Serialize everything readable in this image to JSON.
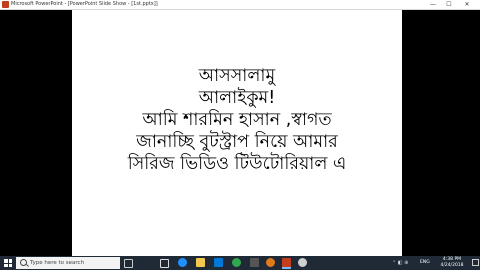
{
  "window": {
    "title": "Microsoft PowerPoint - [PowerPoint Slide Show - [1st.pptx]]",
    "minimize_glyph": "—",
    "maximize_glyph": "☐",
    "close_glyph": "✕"
  },
  "slide": {
    "lines": [
      "আসসালামু",
      "আলাইকুম!",
      "আমি শারমিন হাসান ,স্বাগত",
      "জানাচ্ছি বুটস্ট্রাপ নিয়ে আমার",
      "সিরিজ ভিডিও টিউটোরিয়াল এ"
    ]
  },
  "taskbar": {
    "search_placeholder": "Type here to search",
    "lang": "ENG",
    "time": "4:38 PM",
    "date": "4/24/2018",
    "colors": {
      "background": "#1f2a36",
      "edge": "#1e90ff",
      "store": "#0078d7",
      "explorer": "#f2c94c",
      "chrome": "#2fa84f",
      "powerpoint": "#c43e1c",
      "app_orange": "#e07b1a",
      "camera": "#cfcfcf"
    },
    "apps": [
      "task-view-icon",
      "edge-icon",
      "file-explorer-icon",
      "store-icon",
      "chrome-icon",
      "calculator-icon",
      "media-icon",
      "powerpoint-icon",
      "app-icon",
      "camera-icon"
    ]
  }
}
